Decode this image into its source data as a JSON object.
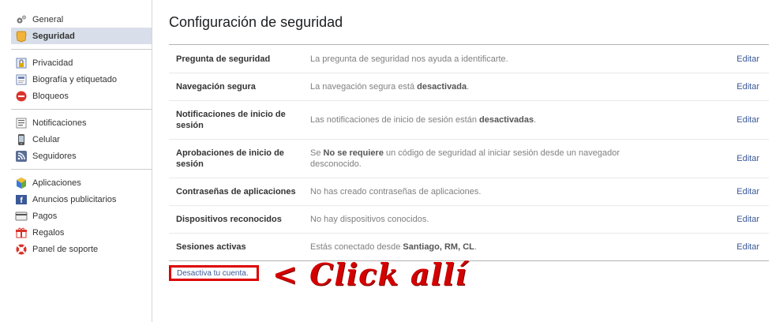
{
  "sidebar": {
    "groups": [
      {
        "items": [
          {
            "label": "General",
            "icon": "gears-icon"
          },
          {
            "label": "Seguridad",
            "icon": "shield-badge-icon",
            "selected": true
          }
        ]
      },
      {
        "items": [
          {
            "label": "Privacidad",
            "icon": "lock-icon"
          },
          {
            "label": "Biografía y etiquetado",
            "icon": "timeline-icon"
          },
          {
            "label": "Bloqueos",
            "icon": "block-icon"
          }
        ]
      },
      {
        "items": [
          {
            "label": "Notificaciones",
            "icon": "notification-icon"
          },
          {
            "label": "Celular",
            "icon": "mobile-icon"
          },
          {
            "label": "Seguidores",
            "icon": "rss-icon"
          }
        ]
      },
      {
        "items": [
          {
            "label": "Aplicaciones",
            "icon": "apps-cube-icon"
          },
          {
            "label": "Anuncios publicitarios",
            "icon": "ads-icon"
          },
          {
            "label": "Pagos",
            "icon": "credit-card-icon"
          },
          {
            "label": "Regalos",
            "icon": "gift-icon"
          },
          {
            "label": "Panel de soporte",
            "icon": "lifebuoy-icon"
          }
        ]
      }
    ]
  },
  "main": {
    "title": "Configuración de seguridad",
    "rows": [
      {
        "label": "Pregunta de seguridad",
        "desc_parts": [
          "La pregunta de seguridad nos ayuda a identificarte."
        ],
        "edit": "Editar"
      },
      {
        "label": "Navegación segura",
        "desc_parts": [
          "La navegación segura está ",
          "desactivada",
          "."
        ],
        "edit": "Editar"
      },
      {
        "label": "Notificaciones de inicio de sesión",
        "desc_parts": [
          "Las notificaciones de inicio de sesión están ",
          "desactivadas",
          "."
        ],
        "edit": "Editar"
      },
      {
        "label": "Aprobaciones de inicio de sesión",
        "desc_parts": [
          "Se ",
          "No se requiere",
          " un código de seguridad al iniciar sesión desde un navegador desconocido."
        ],
        "edit": "Editar"
      },
      {
        "label": "Contraseñas de aplicaciones",
        "desc_parts": [
          "No has creado contraseñas de aplicaciones."
        ],
        "edit": "Editar"
      },
      {
        "label": "Dispositivos reconocidos",
        "desc_parts": [
          "No hay dispositivos conocidos."
        ],
        "edit": "Editar"
      },
      {
        "label": "Sesiones activas",
        "desc_parts": [
          "Estás conectado desde ",
          "Santiago, RM, CL",
          "."
        ],
        "edit": "Editar"
      }
    ],
    "deactivate_link": "Desactiva tu cuenta.",
    "annotation": "< Click allí"
  },
  "colors": {
    "link": "#3b5998",
    "selected_bg": "#d8dfea",
    "annotation": "#d40000"
  }
}
